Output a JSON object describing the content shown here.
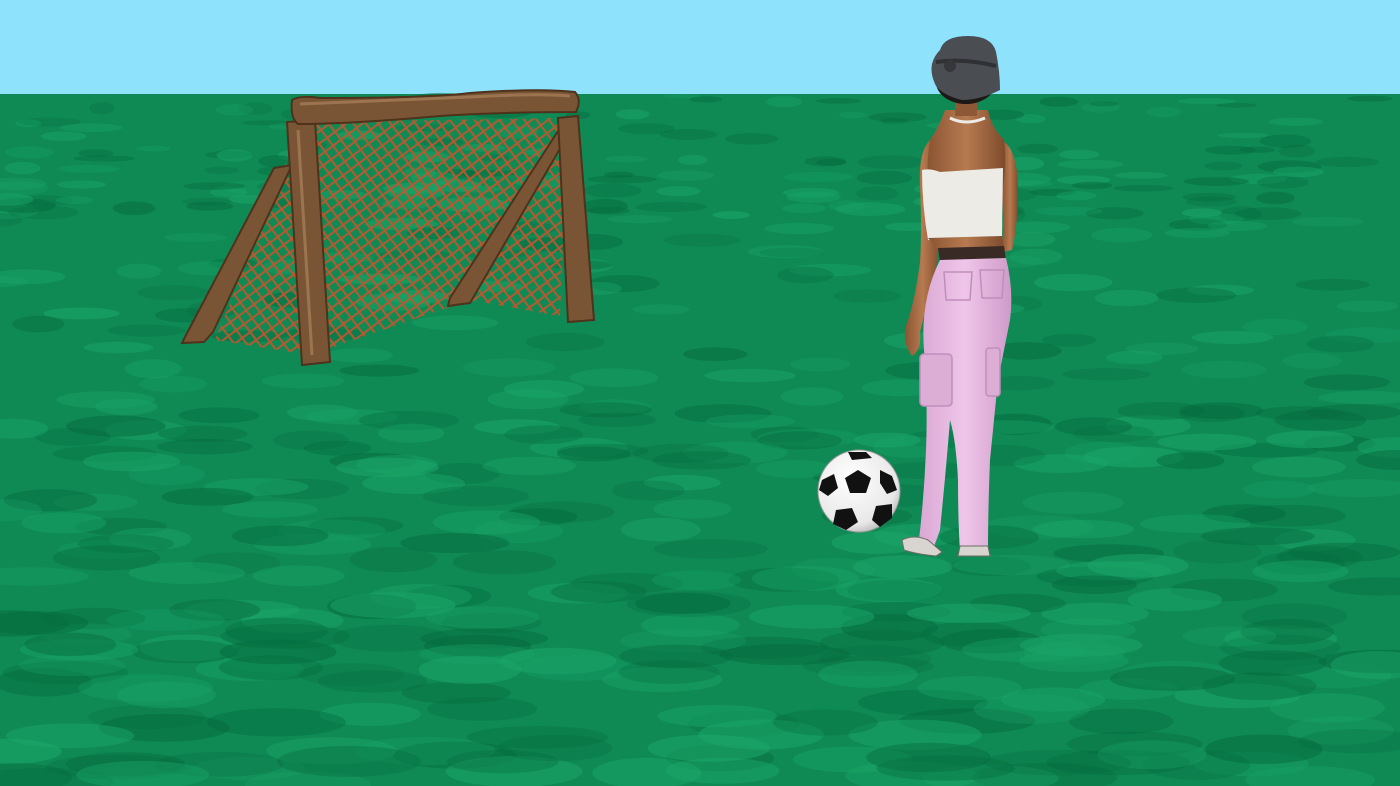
{
  "scene": {
    "colors": {
      "sky": "#8ee2fc",
      "grass_base": "#0f8a55",
      "grass_light": "#1ba76a",
      "grass_dark": "#066b3f",
      "goal_wood": "#7a5535",
      "goal_wood_dark": "#4e321b",
      "goal_net": "#c0562e",
      "ball_white": "#ffffff",
      "ball_black": "#111111",
      "hat": "#4a4d52",
      "skin": "#a86b44",
      "top": "#ecebe6",
      "belt": "#3a2a26",
      "pants": "#e5b9de",
      "shoes": "#d8d4cf"
    },
    "objects": [
      {
        "name": "sky",
        "icon": "sky"
      },
      {
        "name": "grass-field",
        "icon": "grass"
      },
      {
        "name": "soccer-goal",
        "icon": "goal-net"
      },
      {
        "name": "soccer-ball",
        "icon": "ball"
      },
      {
        "name": "player-avatar",
        "icon": "person"
      }
    ]
  }
}
